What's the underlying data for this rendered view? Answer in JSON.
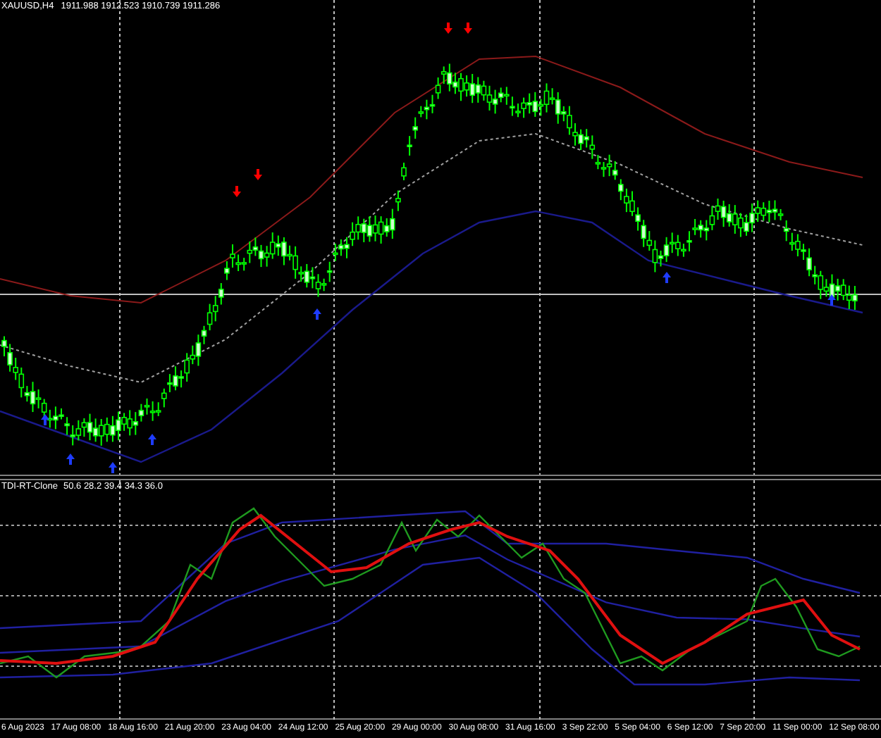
{
  "main_chart": {
    "symbol": "XAUUSD,H4",
    "quotes": [
      "1911.988",
      "1912.523",
      "1910.739",
      "1911.286"
    ]
  },
  "indicator": {
    "name": "TDI-RT-Clone",
    "values": [
      "50.6",
      "28.2",
      "39.4",
      "34.3",
      "36.0"
    ]
  },
  "time_axis": [
    "6 Aug 2023",
    "17 Aug 08:00",
    "18 Aug 16:00",
    "21 Aug 20:00",
    "23 Aug 04:00",
    "24 Aug 12:00",
    "25 Aug 20:00",
    "29 Aug 00:00",
    "30 Aug 08:00",
    "31 Aug 16:00",
    "3 Sep 22:00",
    "5 Sep 04:00",
    "6 Sep 12:00",
    "7 Sep 20:00",
    "11 Sep 00:00",
    "12 Sep 08:00"
  ]
}
